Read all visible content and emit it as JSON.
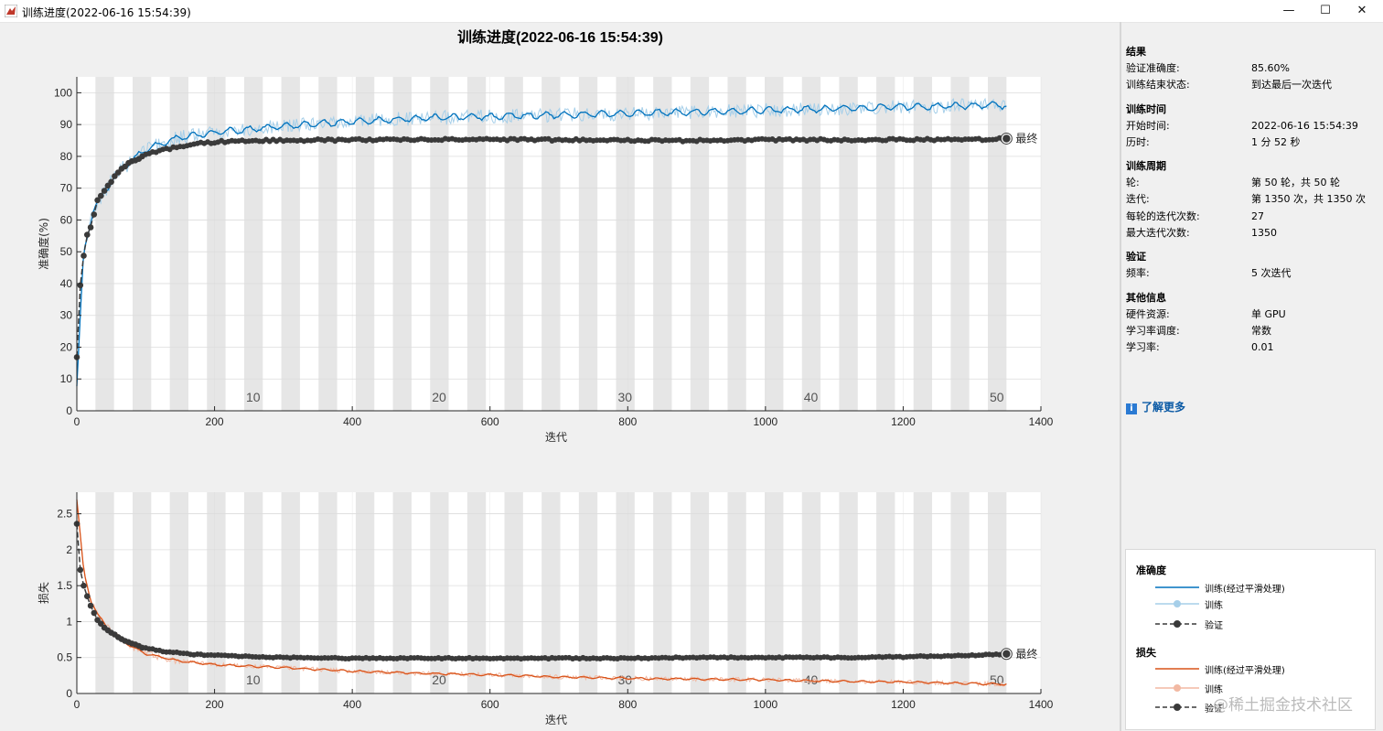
{
  "window": {
    "title": "训练进度(2022-06-16 15:54:39)",
    "minimize_glyph": "—",
    "maximize_glyph": "☐",
    "close_glyph": "✕"
  },
  "header": {
    "title": "训练进度(2022-06-16 15:54:39)"
  },
  "info_panel": {
    "results_title": "结果",
    "val_acc_label": "验证准确度:",
    "val_acc_value": "85.60%",
    "end_status_label": "训练结束状态:",
    "end_status_value": "到达最后一次迭代",
    "time_title": "训练时间",
    "start_label": "开始时间:",
    "start_value": "2022-06-16 15:54:39",
    "elapsed_label": "历时:",
    "elapsed_value": "1 分 52 秒",
    "cycle_title": "训练周期",
    "epoch_label": "轮:",
    "epoch_value": "第 50 轮，共 50 轮",
    "iter_label": "迭代:",
    "iter_value": "第 1350 次，共 1350 次",
    "iter_per_epoch_label": "每轮的迭代次数:",
    "iter_per_epoch_value": "27",
    "max_iter_label": "最大迭代次数:",
    "max_iter_value": "1350",
    "val_title": "验证",
    "freq_label": "频率:",
    "freq_value": "5 次迭代",
    "other_title": "其他信息",
    "hw_label": "硬件资源:",
    "hw_value": "单 GPU",
    "lr_sched_label": "学习率调度:",
    "lr_sched_value": "常数",
    "lr_label": "学习率:",
    "lr_value": "0.01",
    "learn_more": "了解更多",
    "info_icon": "info-icon"
  },
  "legend": {
    "acc_title": "准确度",
    "acc_smooth": "训练(经过平滑处理)",
    "acc_train": "训练",
    "acc_val": "验证",
    "loss_title": "损失",
    "loss_smooth": "训练(经过平滑处理)",
    "loss_train": "训练",
    "loss_val": "验证"
  },
  "watermark": "@稀土掘金技术社区",
  "colors": {
    "acc_smooth": "#0072bd",
    "acc_raw": "#a6cfe9",
    "loss_smooth": "#d95319",
    "loss_raw": "#f2b9a3",
    "validation": "#3a3a3a",
    "epoch_band": "#e6e6e6"
  },
  "chart_data": [
    {
      "type": "line",
      "xlabel": "迭代",
      "ylabel": "准确度(%)",
      "xlim": [
        0,
        1400
      ],
      "ylim": [
        0,
        105
      ],
      "xticks": [
        0,
        200,
        400,
        600,
        800,
        1000,
        1200,
        1400
      ],
      "yticks": [
        0,
        10,
        20,
        30,
        40,
        50,
        60,
        70,
        80,
        90,
        100
      ],
      "epoch_labels": [
        10,
        20,
        30,
        40,
        50
      ],
      "epoch_label_iterations": [
        256,
        526,
        796,
        1066,
        1336
      ],
      "iterations_per_epoch": 27,
      "final_marker_label": "最终",
      "series": [
        {
          "name": "训练(经过平滑处理)",
          "x": [
            0,
            10,
            25,
            50,
            75,
            100,
            150,
            200,
            300,
            400,
            500,
            600,
            700,
            800,
            900,
            1000,
            1100,
            1200,
            1300,
            1350
          ],
          "y": [
            8,
            50,
            64,
            72,
            78,
            82,
            86,
            87.5,
            89.5,
            91,
            92,
            92.5,
            93,
            93.5,
            94,
            94.5,
            95,
            95.5,
            96,
            96
          ]
        },
        {
          "name": "训练",
          "x": [
            0,
            10,
            25,
            50,
            75,
            100,
            150,
            200,
            300,
            400,
            500,
            600,
            700,
            800,
            900,
            1000,
            1100,
            1200,
            1300,
            1350
          ],
          "y": [
            8,
            50,
            64,
            72,
            78,
            82,
            86,
            87.5,
            89.5,
            91,
            92,
            92.5,
            93,
            93.5,
            94,
            94.5,
            95,
            95.5,
            96,
            96
          ]
        },
        {
          "name": "验证",
          "x": [
            0,
            5,
            10,
            15,
            20,
            25,
            30,
            40,
            50,
            60,
            70,
            80,
            90,
            100,
            125,
            150,
            175,
            200,
            250,
            300,
            400,
            500,
            600,
            700,
            800,
            900,
            1000,
            1100,
            1200,
            1300,
            1350
          ],
          "y": [
            17,
            39.5,
            49,
            55,
            58,
            62,
            66,
            69.5,
            72,
            75,
            76.8,
            78.5,
            79.5,
            80.5,
            82,
            83,
            84,
            84.5,
            85,
            85,
            85.2,
            85.3,
            85.3,
            85.2,
            85,
            85,
            85.2,
            85.2,
            85.3,
            85.2,
            85.6
          ]
        }
      ]
    },
    {
      "type": "line",
      "xlabel": "迭代",
      "ylabel": "损失",
      "xlim": [
        0,
        1400
      ],
      "ylim": [
        0,
        2.8
      ],
      "xticks": [
        0,
        200,
        400,
        600,
        800,
        1000,
        1200,
        1400
      ],
      "yticks": [
        0,
        0.5,
        1,
        1.5,
        2,
        2.5
      ],
      "epoch_labels": [
        10,
        20,
        30,
        40,
        50
      ],
      "epoch_label_iterations": [
        256,
        526,
        796,
        1066,
        1336
      ],
      "iterations_per_epoch": 27,
      "final_marker_label": "最终",
      "series": [
        {
          "name": "训练(经过平滑处理)",
          "x": [
            0,
            5,
            10,
            20,
            30,
            50,
            75,
            100,
            150,
            200,
            300,
            400,
            500,
            600,
            700,
            800,
            900,
            1000,
            1100,
            1200,
            1300,
            1350
          ],
          "y": [
            2.7,
            2.2,
            1.7,
            1.3,
            1.1,
            0.85,
            0.68,
            0.55,
            0.45,
            0.4,
            0.36,
            0.31,
            0.28,
            0.26,
            0.23,
            0.21,
            0.2,
            0.19,
            0.17,
            0.16,
            0.14,
            0.13
          ]
        },
        {
          "name": "训练",
          "x": [
            0,
            5,
            10,
            20,
            30,
            50,
            75,
            100,
            150,
            200,
            300,
            400,
            500,
            600,
            700,
            800,
            900,
            1000,
            1100,
            1200,
            1300,
            1350
          ],
          "y": [
            2.7,
            2.2,
            1.7,
            1.3,
            1.1,
            0.85,
            0.68,
            0.55,
            0.45,
            0.4,
            0.36,
            0.31,
            0.28,
            0.26,
            0.23,
            0.21,
            0.2,
            0.19,
            0.17,
            0.16,
            0.14,
            0.13
          ]
        },
        {
          "name": "验证",
          "x": [
            0,
            5,
            10,
            15,
            20,
            25,
            30,
            40,
            50,
            60,
            70,
            80,
            90,
            100,
            125,
            150,
            175,
            200,
            300,
            400,
            500,
            600,
            700,
            800,
            900,
            1000,
            1100,
            1200,
            1300,
            1350
          ],
          "y": [
            2.36,
            1.72,
            1.5,
            1.35,
            1.22,
            1.12,
            1.02,
            0.92,
            0.85,
            0.79,
            0.73,
            0.69,
            0.66,
            0.63,
            0.59,
            0.56,
            0.54,
            0.53,
            0.5,
            0.49,
            0.49,
            0.49,
            0.49,
            0.49,
            0.5,
            0.5,
            0.5,
            0.51,
            0.53,
            0.55
          ]
        }
      ]
    }
  ]
}
